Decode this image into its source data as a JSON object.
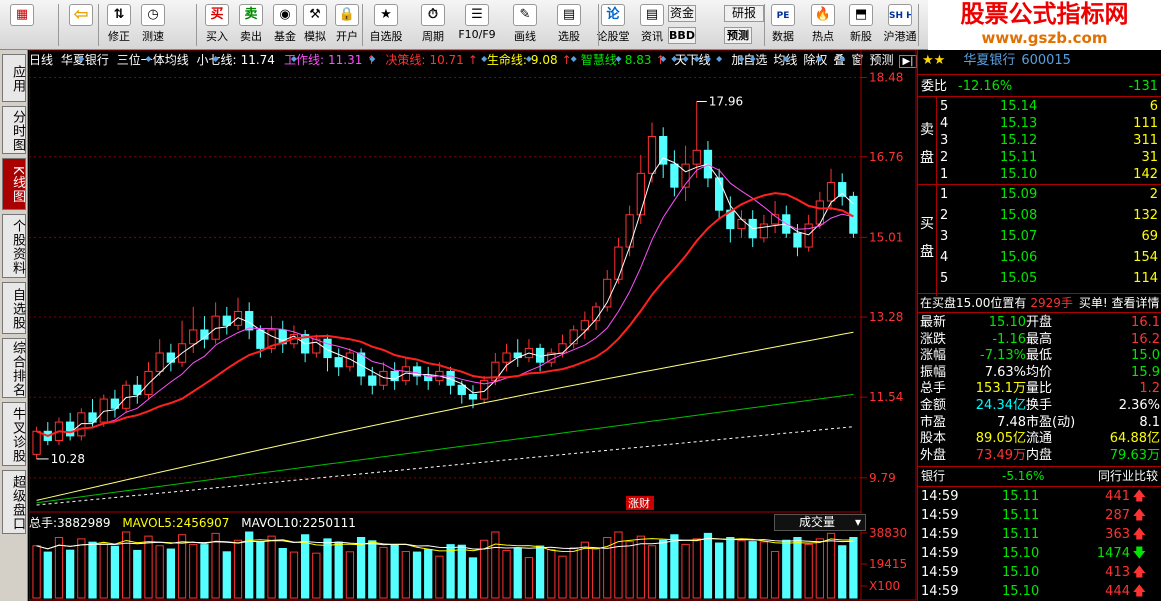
{
  "toolbar": {
    "items": [
      {
        "label": "",
        "icon": "grid-icon"
      },
      {
        "label": "",
        "icon": "back-arrow-icon"
      },
      {
        "label": "修正",
        "icon": "up-down-icon"
      },
      {
        "label": "测速",
        "icon": "speed-icon"
      },
      {
        "label": "买入",
        "icon": "buy-icon",
        "glyph": "买"
      },
      {
        "label": "卖出",
        "icon": "sell-icon",
        "glyph": "卖"
      },
      {
        "label": "基金",
        "icon": "fund-icon"
      },
      {
        "label": "模拟",
        "icon": "hammer-icon"
      },
      {
        "label": "开户",
        "icon": "lock-icon"
      },
      {
        "label": "自选股",
        "icon": "favorites-icon"
      },
      {
        "label": "周期",
        "icon": "period-icon"
      },
      {
        "label": "F10/F9",
        "icon": "f10-icon"
      },
      {
        "label": "画线",
        "icon": "pen-icon"
      },
      {
        "label": "选股",
        "icon": "filter-icon"
      },
      {
        "label": "论股堂",
        "icon": "forum-icon",
        "glyph": "论"
      },
      {
        "label": "资讯",
        "icon": "news-icon"
      },
      {
        "label": "资金",
        "icon": "fund-flow-icon"
      },
      {
        "label": "BBD",
        "icon": "bbd-icon"
      },
      {
        "label": "研报",
        "icon": "report-icon"
      },
      {
        "label": "预测",
        "icon": "forecast-icon"
      },
      {
        "label": "数据",
        "icon": "data-icon",
        "glyph": "PE"
      },
      {
        "label": "热点",
        "icon": "hot-icon"
      },
      {
        "label": "新股",
        "icon": "ipo-icon"
      },
      {
        "label": "沪港通",
        "icon": "hk-connect-icon",
        "glyph": "SH HK"
      }
    ]
  },
  "brand": {
    "title": "股票公式指标网",
    "url": "www.gszb.com"
  },
  "left_tabs": [
    "应用",
    "分时图",
    "K线图",
    "个股资料",
    "自选股",
    "综合排名",
    "牛叉诊股",
    "超级盘口"
  ],
  "active_tab": "K线图",
  "chart": {
    "period": "日线",
    "name": "华夏银行",
    "indicator": "三位一体均线",
    "lines": [
      {
        "label": "小七线:",
        "value": "11.74",
        "color": "#ffffff"
      },
      {
        "label": "工作线:",
        "value": "11.31",
        "color": "#ff50ff",
        "arrow": "↑"
      },
      {
        "label": "决策线:",
        "value": "10.71",
        "color": "#ff3232",
        "arrow": "↑"
      },
      {
        "label": "生命线:",
        "value": "9.08",
        "color": "#ffff00",
        "arrow": "↑"
      },
      {
        "label": "智慧线:",
        "value": "8.83",
        "color": "#00e600",
        "arrow": "↑"
      },
      {
        "label": "天下线",
        "value": "",
        "color": "#ffffff"
      }
    ],
    "buttons": [
      "加自选",
      "均线",
      "除权",
      "叠",
      "窗",
      "预测"
    ],
    "y_ticks": [
      "18.48",
      "16.76",
      "15.01",
      "13.28",
      "11.54",
      "9.79"
    ],
    "high_label": "17.96",
    "low_label": "10.28",
    "event_tag": "涨财",
    "volume": {
      "total_label": "总手:",
      "total": "3882989",
      "mavol5_label": "MAVOL5:",
      "mavol5": "2456907",
      "mavol10_label": "MAVOL10:",
      "mavol10": "2250111",
      "selector": "成交量",
      "y_ticks": [
        "38830",
        "19415",
        "X100"
      ]
    }
  },
  "chart_data": {
    "type": "candlestick",
    "title": "华夏银行 日线",
    "ylim": [
      9.2,
      18.6
    ],
    "candles": [
      [
        10.3,
        10.8,
        10.2,
        10.9
      ],
      [
        10.8,
        10.6,
        10.5,
        11.0
      ],
      [
        10.6,
        11.0,
        10.5,
        11.1
      ],
      [
        11.0,
        10.7,
        10.6,
        11.2
      ],
      [
        10.7,
        11.2,
        10.6,
        11.3
      ],
      [
        11.2,
        11.0,
        10.9,
        11.5
      ],
      [
        11.0,
        11.5,
        10.9,
        11.6
      ],
      [
        11.5,
        11.3,
        11.1,
        11.7
      ],
      [
        11.3,
        11.8,
        11.2,
        11.9
      ],
      [
        11.8,
        11.6,
        11.4,
        12.0
      ],
      [
        11.6,
        12.1,
        11.5,
        12.3
      ],
      [
        12.1,
        12.5,
        12.0,
        12.8
      ],
      [
        12.5,
        12.3,
        12.1,
        12.7
      ],
      [
        12.3,
        12.7,
        12.2,
        13.2
      ],
      [
        12.7,
        13.0,
        12.5,
        13.5
      ],
      [
        13.0,
        12.8,
        12.6,
        13.3
      ],
      [
        12.8,
        13.3,
        12.7,
        13.6
      ],
      [
        13.3,
        13.1,
        12.9,
        13.5
      ],
      [
        13.1,
        13.4,
        13.0,
        13.7
      ],
      [
        13.4,
        13.0,
        12.8,
        13.6
      ],
      [
        13.0,
        12.6,
        12.4,
        13.1
      ],
      [
        12.6,
        13.0,
        12.5,
        13.3
      ],
      [
        13.0,
        12.7,
        12.5,
        13.2
      ],
      [
        12.7,
        12.9,
        12.6,
        13.1
      ],
      [
        12.9,
        12.5,
        12.3,
        13.0
      ],
      [
        12.5,
        12.8,
        12.4,
        12.9
      ],
      [
        12.8,
        12.4,
        12.1,
        12.9
      ],
      [
        12.4,
        12.2,
        12.0,
        12.6
      ],
      [
        12.2,
        12.5,
        12.1,
        12.6
      ],
      [
        12.5,
        12.0,
        11.8,
        12.6
      ],
      [
        12.0,
        11.8,
        11.6,
        12.2
      ],
      [
        11.8,
        12.1,
        11.7,
        12.3
      ],
      [
        12.1,
        11.9,
        11.7,
        12.3
      ],
      [
        11.9,
        12.2,
        11.8,
        12.4
      ],
      [
        12.2,
        12.0,
        11.8,
        12.3
      ],
      [
        12.0,
        11.9,
        11.7,
        12.2
      ],
      [
        11.9,
        12.1,
        11.8,
        12.3
      ],
      [
        12.1,
        11.8,
        11.6,
        12.2
      ],
      [
        11.8,
        11.6,
        11.4,
        11.9
      ],
      [
        11.6,
        11.5,
        11.3,
        11.8
      ],
      [
        11.5,
        11.9,
        11.4,
        12.0
      ],
      [
        11.9,
        12.3,
        11.8,
        12.5
      ],
      [
        12.3,
        12.5,
        12.1,
        12.7
      ],
      [
        12.5,
        12.4,
        12.2,
        12.8
      ],
      [
        12.4,
        12.6,
        12.3,
        12.8
      ],
      [
        12.6,
        12.3,
        12.1,
        12.7
      ],
      [
        12.3,
        12.5,
        12.2,
        12.6
      ],
      [
        12.5,
        12.7,
        12.4,
        12.9
      ],
      [
        12.7,
        13.0,
        12.6,
        13.1
      ],
      [
        13.0,
        13.2,
        12.8,
        13.4
      ],
      [
        13.2,
        13.5,
        13.0,
        13.6
      ],
      [
        13.5,
        14.1,
        13.4,
        14.3
      ],
      [
        14.1,
        14.8,
        14.0,
        15.0
      ],
      [
        14.8,
        15.5,
        14.6,
        15.7
      ],
      [
        15.5,
        16.4,
        15.3,
        16.8
      ],
      [
        16.4,
        17.2,
        16.2,
        17.5
      ],
      [
        17.2,
        16.6,
        16.3,
        17.4
      ],
      [
        16.6,
        16.1,
        15.9,
        16.9
      ],
      [
        16.1,
        16.6,
        15.8,
        17.0
      ],
      [
        16.6,
        16.9,
        16.3,
        17.96
      ],
      [
        16.9,
        16.3,
        16.1,
        17.1
      ],
      [
        16.3,
        15.6,
        15.4,
        16.5
      ],
      [
        15.6,
        15.2,
        14.9,
        15.9
      ],
      [
        15.2,
        15.4,
        15.0,
        15.6
      ],
      [
        15.4,
        15.0,
        14.8,
        15.6
      ],
      [
        15.0,
        15.3,
        14.9,
        15.5
      ],
      [
        15.3,
        15.5,
        15.1,
        15.8
      ],
      [
        15.5,
        15.1,
        15.0,
        15.7
      ],
      [
        15.1,
        14.8,
        14.6,
        15.3
      ],
      [
        14.8,
        15.3,
        14.7,
        15.5
      ],
      [
        15.3,
        15.8,
        15.2,
        16.0
      ],
      [
        15.8,
        16.2,
        15.6,
        16.5
      ],
      [
        16.2,
        15.9,
        15.7,
        16.4
      ],
      [
        15.9,
        15.1,
        15.0,
        16.0
      ]
    ]
  },
  "panel": {
    "title": "华夏银行",
    "code": "600015",
    "stars": "★★",
    "weibi_label": "委比",
    "weibi": "-12.16%",
    "weicha": "-131",
    "sell_label": "卖盘",
    "buy_label": "买盘",
    "sell": [
      {
        "level": "5",
        "price": "15.14",
        "vol": "6"
      },
      {
        "level": "4",
        "price": "15.13",
        "vol": "111"
      },
      {
        "level": "3",
        "price": "15.12",
        "vol": "311"
      },
      {
        "level": "2",
        "price": "15.11",
        "vol": "31"
      },
      {
        "level": "1",
        "price": "15.10",
        "vol": "142"
      }
    ],
    "buy": [
      {
        "level": "1",
        "price": "15.09",
        "vol": "2"
      },
      {
        "level": "2",
        "price": "15.08",
        "vol": "132"
      },
      {
        "level": "3",
        "price": "15.07",
        "vol": "69"
      },
      {
        "level": "4",
        "price": "15.06",
        "vol": "154"
      },
      {
        "level": "5",
        "price": "15.05",
        "vol": "114"
      }
    ],
    "notice": "在买盘15.00位置有",
    "notice_vol": "2929手",
    "notice_link": "买单! 查看详情",
    "stats": [
      {
        "l1": "最新",
        "v1": "15.10",
        "c1": "#00e600",
        "l2": "开盘",
        "v2": "16.1",
        "c2": "#ff3232"
      },
      {
        "l1": "涨跌",
        "v1": "-1.16",
        "c1": "#00e600",
        "l2": "最高",
        "v2": "16.2",
        "c2": "#ff3232"
      },
      {
        "l1": "涨幅",
        "v1": "-7.13%",
        "c1": "#00e600",
        "l2": "最低",
        "v2": "15.0",
        "c2": "#00e600"
      },
      {
        "l1": "振幅",
        "v1": "7.63%",
        "c1": "#ffffff",
        "l2": "均价",
        "v2": "15.9",
        "c2": "#00e600"
      },
      {
        "l1": "总手",
        "v1": "153.1万",
        "c1": "#ffff00",
        "l2": "量比",
        "v2": "1.2",
        "c2": "#ff3232"
      },
      {
        "l1": "金额",
        "v1": "24.34亿",
        "c1": "#00ffff",
        "l2": "换手",
        "v2": "2.36%",
        "c2": "#ffffff"
      },
      {
        "l1": "市盈",
        "v1": "7.48",
        "c1": "#ffffff",
        "l2": "市盈(动)",
        "v2": "8.1",
        "c2": "#ffffff"
      },
      {
        "l1": "股本",
        "v1": "89.05亿",
        "c1": "#ffff00",
        "l2": "流通",
        "v2": "64.88亿",
        "c2": "#ffff00"
      },
      {
        "l1": "外盘",
        "v1": "73.49万",
        "c1": "#ff3232",
        "l2": "内盘",
        "v2": "79.63万",
        "c2": "#00e600"
      }
    ],
    "sector": {
      "name": "银行",
      "change": "-5.16%",
      "link": "同行业比较"
    },
    "ticks": [
      {
        "time": "14:59",
        "price": "15.11",
        "vol": "441",
        "dir": "up"
      },
      {
        "time": "14:59",
        "price": "15.11",
        "vol": "287",
        "dir": "up"
      },
      {
        "time": "14:59",
        "price": "15.11",
        "vol": "363",
        "dir": "up"
      },
      {
        "time": "14:59",
        "price": "15.10",
        "vol": "1474",
        "dir": "down"
      },
      {
        "time": "14:59",
        "price": "15.10",
        "vol": "413",
        "dir": "up"
      },
      {
        "time": "14:59",
        "price": "15.10",
        "vol": "444",
        "dir": "up"
      }
    ]
  }
}
